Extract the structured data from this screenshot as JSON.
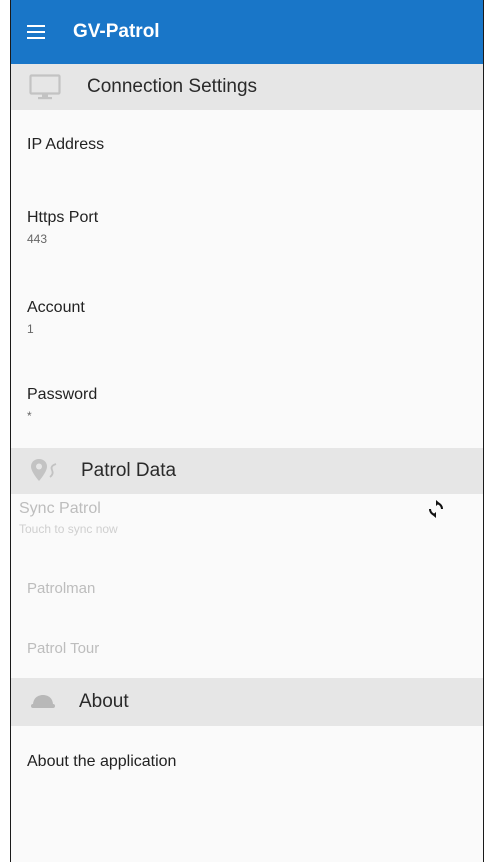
{
  "appbar": {
    "title": "GV-Patrol",
    "menu_icon": "hamburger-menu-icon"
  },
  "sections": {
    "connection": {
      "title": "Connection Settings",
      "icon": "monitor-icon",
      "items": {
        "ip": {
          "title": "IP Address",
          "summary": ""
        },
        "port": {
          "title": "Https Port",
          "summary": "443"
        },
        "account": {
          "title": "Account",
          "summary": "1"
        },
        "password": {
          "title": "Password",
          "summary": "*"
        }
      }
    },
    "patrol": {
      "title": "Patrol Data",
      "icon": "map-pin-icon",
      "items": {
        "sync": {
          "title": "Sync Patrol",
          "summary": "Touch to sync now",
          "icon": "sync-icon"
        },
        "patrolman": {
          "title": "Patrolman"
        },
        "tour": {
          "title": "Patrol Tour"
        }
      }
    },
    "about": {
      "title": "About",
      "icon": "police-cap-icon",
      "items": {
        "about_app": {
          "title": "About the application"
        }
      }
    }
  },
  "colors": {
    "appbar": "#1976c8",
    "section_bg": "#e6e6e6",
    "background": "#fafafa",
    "disabled_text": "#bdbdbd"
  }
}
